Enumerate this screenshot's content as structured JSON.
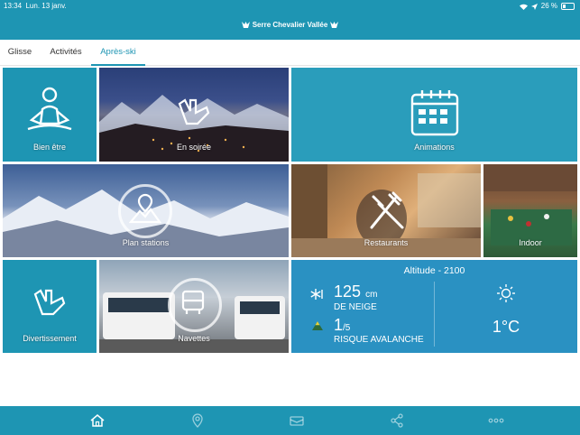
{
  "status_bar": {
    "time": "13:34",
    "date": "Lun. 13 janv.",
    "battery": "26 %"
  },
  "app": {
    "title": "Serre Chevalier Vallée"
  },
  "tabs": [
    {
      "label": "Glisse",
      "active": false
    },
    {
      "label": "Activités",
      "active": false
    },
    {
      "label": "Après-ski",
      "active": true
    }
  ],
  "tiles": {
    "bien_etre": "Bien être",
    "en_soiree": "En soirée",
    "animations": "Animations",
    "plan_stations": "Plan stations",
    "restaurants": "Restaurants",
    "indoor": "Indoor",
    "divertissement": "Divertissement",
    "navettes": "Navettes"
  },
  "weather": {
    "altitude": "Altitude - 2100",
    "snow_value": "125",
    "snow_unit": "cm",
    "snow_label": "DE NEIGE",
    "avalanche_value": "1",
    "avalanche_scale": "/5",
    "avalanche_label": "RISQUE AVALANCHE",
    "temperature": "1°C"
  },
  "bottom_nav": [
    "home-icon",
    "location-pin-icon",
    "ticket-icon",
    "share-icon",
    "more-icon"
  ],
  "colors": {
    "accent": "#1e95b3",
    "weather_tile": "#2a91c2"
  }
}
